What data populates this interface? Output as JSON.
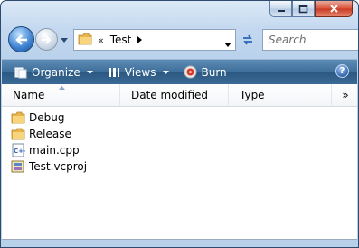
{
  "address": {
    "overflow_glyph": "«",
    "current_folder": "Test"
  },
  "search": {
    "placeholder": "Search"
  },
  "toolbar": {
    "organize_label": "Organize",
    "views_label": "Views",
    "burn_label": "Burn",
    "help_glyph": "?"
  },
  "columns": {
    "name": "Name",
    "date_modified": "Date modified",
    "type": "Type",
    "more": "»"
  },
  "files": [
    {
      "name": "Debug",
      "icon": "folder-icon"
    },
    {
      "name": "Release",
      "icon": "folder-icon"
    },
    {
      "name": "main.cpp",
      "icon": "cpp-file-icon"
    },
    {
      "name": "Test.vcproj",
      "icon": "vcproj-file-icon"
    }
  ],
  "colors": {
    "toolbar": "#3e6e9a",
    "close_button": "#c93a22",
    "folder": "#e8b54a"
  }
}
